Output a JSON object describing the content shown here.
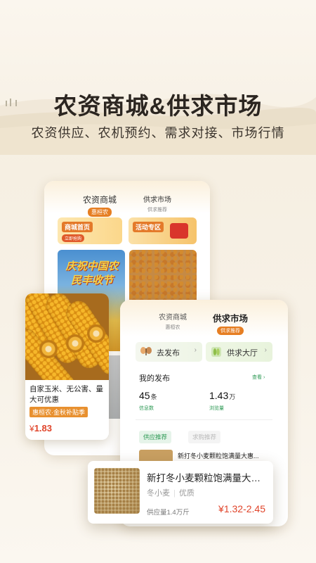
{
  "hero": {
    "title": "农资商城&供求市场",
    "subtitle": "农资供应、农机预约、需求对接、市场行情"
  },
  "back_card": {
    "tab_mall": "农资商城",
    "tab_mall_badge": "惠桓农",
    "tab_market": "供求市场",
    "tab_market_sub": "供求推荐",
    "banner_mall_label": "商城首页",
    "banner_mall_button": "立即抢购",
    "banner_activity_label": "活动专区",
    "festival_text": "庆祝中国农民丰收节",
    "faint_text": "实"
  },
  "corn_card": {
    "title": "自家玉米、无公害、量大可优惠",
    "badge": "惠桓农·金秋补贴季",
    "currency": "¥",
    "price": "1.83"
  },
  "front_card": {
    "tab_mall": "农资商城",
    "tab_mall_sub": "惠桓农",
    "tab_market": "供求市场",
    "tab_market_badge": "供求推荐",
    "action_publish": "去发布",
    "action_hall": "供求大厅",
    "arrow": "›",
    "my_posts_title": "我的发布",
    "view_more": "查看 ›",
    "stat_info_num": "45",
    "stat_info_unit": "条",
    "stat_info_label": "信息数",
    "stat_views_num": "1.43",
    "stat_views_unit": "万",
    "stat_views_label": "浏览量",
    "chip_supply": "供应推荐",
    "chip_purchase": "求购推荐",
    "row_title": "新打冬小麦颗粒饱满量大惠..."
  },
  "popout": {
    "title": "新打冬小麦颗粒饱满量大惠…",
    "tag1": "冬小麦",
    "sep": "|",
    "tag2": "优质",
    "supply": "供应量1.4万斤",
    "price": "¥1.32-2.45"
  },
  "colors": {
    "accent_orange": "#e67e22",
    "accent_green": "#2e9a55",
    "price_red": "#e0442a"
  }
}
